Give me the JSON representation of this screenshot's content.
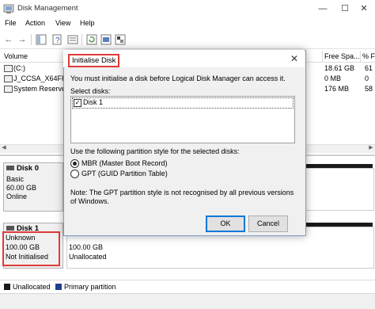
{
  "window": {
    "title": "Disk Management",
    "minimize": "—",
    "maximize": "☐",
    "close": "✕"
  },
  "menu": [
    "File",
    "Action",
    "View",
    "Help"
  ],
  "volume_list": {
    "columns": [
      "Volume",
      "Free Spa...",
      "% F"
    ],
    "rows": [
      {
        "name": "(C:)",
        "free": "18.61 GB",
        "pct": "61"
      },
      {
        "name": "J_CCSA_X64FRE_...",
        "free": "0 MB",
        "pct": "0"
      },
      {
        "name": "System Reserved",
        "free": "176 MB",
        "pct": "58"
      }
    ]
  },
  "disks": [
    {
      "name": "Disk 0",
      "type": "Basic",
      "size": "60.00 GB",
      "status": "Online"
    },
    {
      "name": "Disk 1",
      "type": "Unknown",
      "size": "100.00 GB",
      "status": "Not Initialised",
      "partition_size": "100.00 GB",
      "partition_status": "Unallocated"
    }
  ],
  "legend": [
    {
      "label": "Unallocated",
      "color": "#1a1a1a"
    },
    {
      "label": "Primary partition",
      "color": "#1f3f8f"
    }
  ],
  "dialog": {
    "title": "Initialise Disk",
    "message": "You must initialise a disk before Logical Disk Manager can access it.",
    "select_label": "Select disks:",
    "disk_item": "Disk 1",
    "style_label": "Use the following partition style for the selected disks:",
    "option_mbr": "MBR (Master Boot Record)",
    "option_gpt": "GPT (GUID Partition Table)",
    "note": "Note: The GPT partition style is not recognised by all previous versions of Windows.",
    "ok": "OK",
    "cancel": "Cancel"
  },
  "colors": {
    "highlight": "#e03a3a",
    "dialog_border": "#7a9cc6",
    "accent_button": "#0078d7"
  }
}
